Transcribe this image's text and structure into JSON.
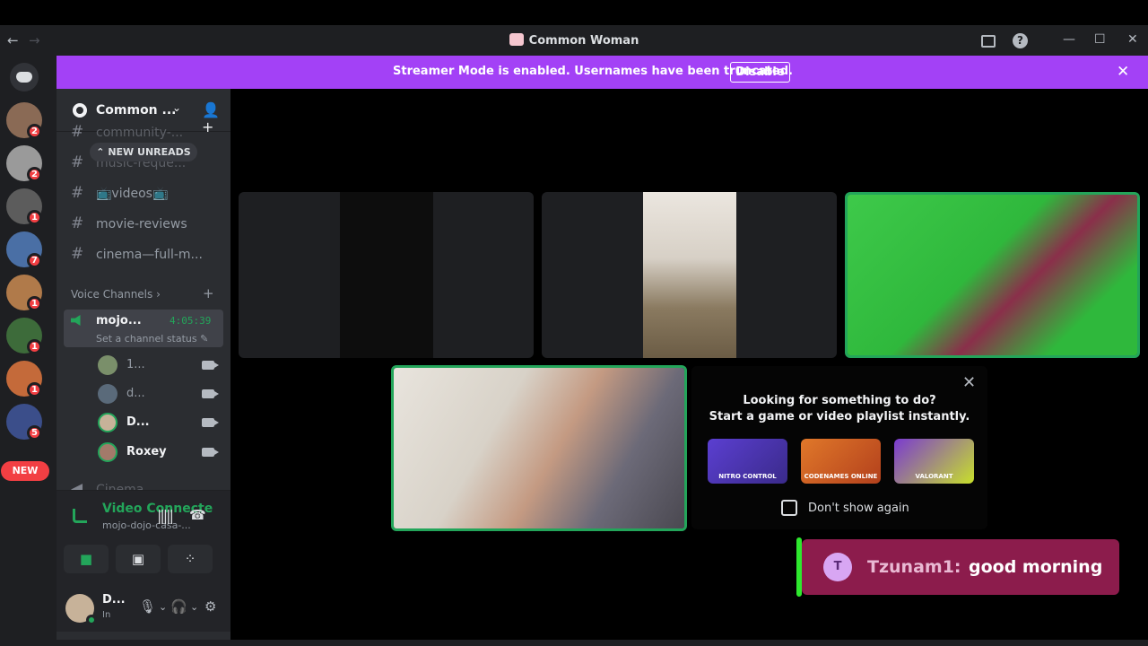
{
  "window": {
    "title": "Common Woman",
    "back": "←",
    "forward": "→",
    "help": "?",
    "minimize": "—",
    "maximize": "☐",
    "close": "✕"
  },
  "banner": {
    "message": "Streamer Mode is enabled. Usernames have been truncated.",
    "action": "Disable",
    "close": "✕"
  },
  "rail": {
    "new_label": "NEW",
    "badges": [
      "2",
      "2",
      "1",
      "7",
      "1",
      "1",
      "1",
      "5"
    ]
  },
  "server": {
    "name": "Common ...",
    "chevron": "⌄",
    "add_member": "👤+"
  },
  "channels": {
    "new_unreads": "⌃ NEW UNREADS",
    "items": [
      {
        "hash": "#",
        "name": "community-..."
      },
      {
        "hash": "#",
        "name": "music-reque..."
      },
      {
        "hash": "#",
        "name": "📺videos📺"
      },
      {
        "hash": "#",
        "name": "movie-reviews"
      },
      {
        "hash": "#",
        "name": "cinema—full-m..."
      }
    ],
    "voice_category": "Voice Channels ›",
    "voice_add": "+",
    "active_voice": {
      "name": "mojo...",
      "time": "4:05:39",
      "status": "Set a channel status ✎"
    },
    "voice_users": [
      "1...",
      "d...",
      "D...",
      "Roxey"
    ],
    "next_channel": "Cinema"
  },
  "rtc": {
    "title": "Video Connecte",
    "subtitle": "mojo-dojo-casa-...",
    "noise": "|||||",
    "hangup": "☎"
  },
  "user_panel": {
    "name": "D...",
    "status": "In",
    "mic": "🎙",
    "headset": "🎧",
    "settings": "⚙",
    "chevron": "⌄"
  },
  "activity": {
    "heading_line1": "Looking for something to do?",
    "heading_line2": "Start a game or video playlist instantly.",
    "close": "✕",
    "cards": [
      "NITRO CONTROL",
      "CODENAMES ONLINE",
      "VALORANT"
    ],
    "checkbox_label": "Don't show again"
  },
  "toast": {
    "avatar_letter": "T",
    "who": "Tzunam1:",
    "text": "good morning"
  },
  "colors": {
    "banner": "#a341f6",
    "speaking": "#23a55a",
    "toast": "#8c1c4c",
    "badge": "#f23f43"
  }
}
